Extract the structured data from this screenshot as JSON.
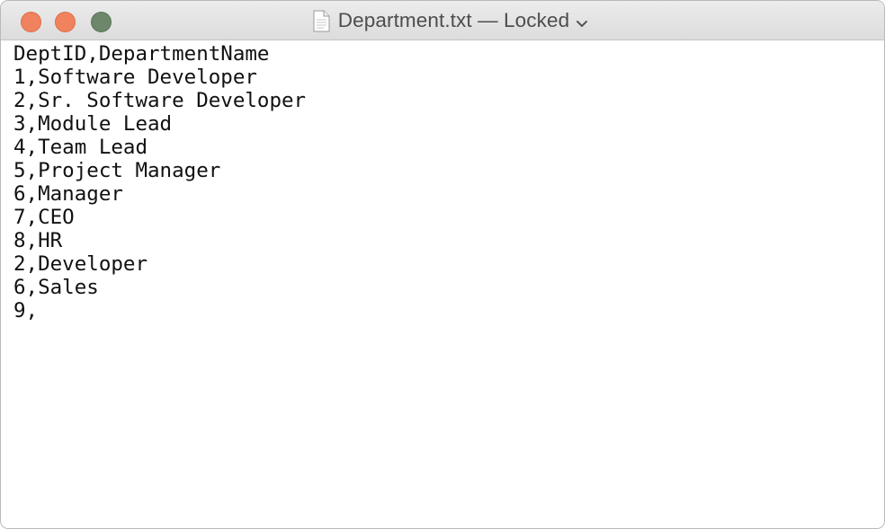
{
  "window": {
    "title": "Department.txt — Locked",
    "icons": {
      "document": "text-document-icon",
      "menu": "chevron-down-icon"
    },
    "colors": {
      "close": "#f0825f",
      "minimize": "#f0835d",
      "zoom": "#6c8769"
    }
  },
  "document": {
    "lines": [
      "DeptID,DepartmentName",
      "1,Software Developer",
      "2,Sr. Software Developer",
      "3,Module Lead",
      "4,Team Lead",
      "5,Project Manager",
      "6,Manager",
      "7,CEO",
      "8,HR",
      "2,Developer",
      "6,Sales",
      "9,"
    ]
  }
}
